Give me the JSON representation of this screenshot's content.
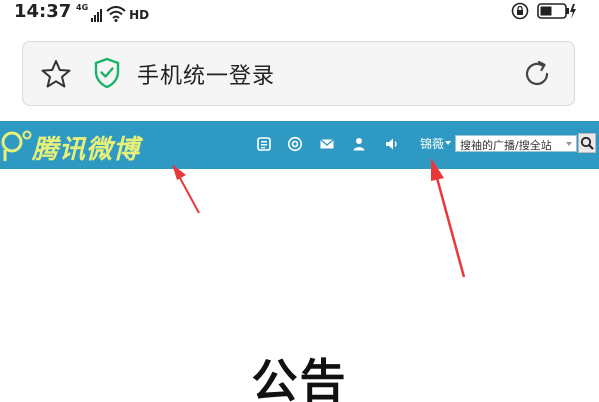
{
  "status_bar": {
    "time": "14:37",
    "network": "4G",
    "hd": "HD"
  },
  "browser": {
    "page_title": "手机统一登录"
  },
  "weibo": {
    "logo_text": "腾讯微博",
    "username": "锦薇",
    "search_placeholder": "搜袖的广播/搜全站",
    "nav_icons": [
      "home-icon",
      "at-mention-icon",
      "mail-icon",
      "user-icon",
      "speaker-icon"
    ]
  },
  "content": {
    "notice_title": "公告"
  },
  "colors": {
    "header_bg": "#2e9ac4",
    "logo": "#e8f07a",
    "arrow": "#e8383a"
  }
}
